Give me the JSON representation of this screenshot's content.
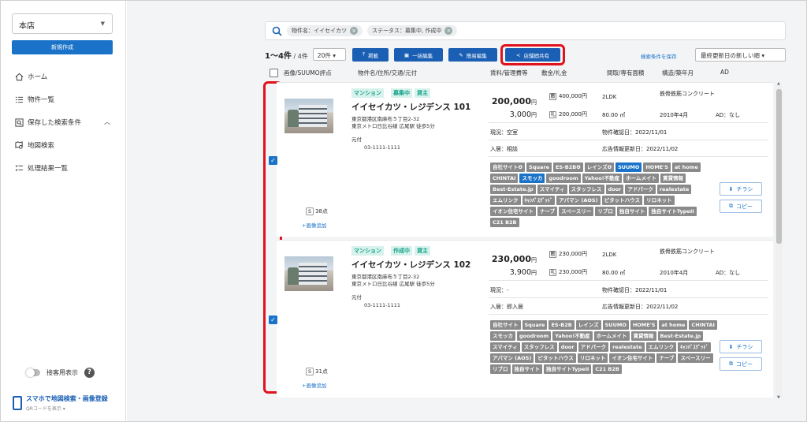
{
  "sidebar": {
    "store": "本店",
    "new_button": "新規作成",
    "nav": {
      "home": "ホーム",
      "list": "物件一覧",
      "saved": "保存した検索条件",
      "map": "地図検索",
      "results": "処理結果一覧"
    },
    "toggle_label": "接客用表示",
    "mobile_title": "スマホで地図検索・画像登録",
    "mobile_sub": "QRコードを表示 ▾"
  },
  "search": {
    "chip1": "物件名：イイセイカツ",
    "chip2": "ステータス：募集中, 作成中"
  },
  "toolbar": {
    "count": "1〜4件",
    "total": " / 4件",
    "per_page": "20件 ▾",
    "publish": "掲載",
    "bulk_edit": "一括編集",
    "quick_edit": "簡易編集",
    "share": "店舗間共有",
    "save_condition": "検索条件を保存",
    "sort": "最終更新日の新しい順 ▾"
  },
  "headers": {
    "image": "画像/SUUMO評点",
    "name": "物件名/住所/交通/元付",
    "rent": "賃料/管理費等",
    "deposit": "敷金/礼金",
    "layout": "間取/専有面積",
    "structure": "構造/築年月",
    "ad": "AD"
  },
  "buttons": {
    "flyer": "チラシ",
    "copy": "コピー"
  },
  "listings": [
    {
      "type": "マンション",
      "status": "募集中",
      "kashi": "貸主",
      "name": "イイセイカツ・レジデンス 101",
      "address": "東京都港区南麻布５丁目2-32",
      "access": "東京メトロ日比谷線 広尾駅 徒歩5分",
      "motozuke": "元付",
      "phone": "03-1111-1111",
      "rent": "200,000",
      "fee": "3,000",
      "yen": "円",
      "deposit_label": "敷",
      "deposit": "400,000円",
      "key_label": "礼",
      "key_money": "200,000円",
      "layout": "2LDK",
      "area": "80.00 ㎡",
      "structure": "鉄骨鉄筋コンクリート",
      "built": "2010年4月",
      "ad": "AD：なし",
      "current": "現況：空室",
      "confirm": "物件確認日：2022/11/01",
      "move_in": "入居：相談",
      "ad_updated": "広告情報更新日：2022/11/02",
      "score": "38点",
      "score_label": "S",
      "add_image": "+画像追加",
      "checked": true,
      "sites": [
        {
          "t": "自社サイト❶",
          "blue": false
        },
        {
          "t": "Square",
          "blue": false
        },
        {
          "t": "ES-B2B❶",
          "blue": false
        },
        {
          "t": "レインズ❶",
          "blue": false
        },
        {
          "t": "SUUMO",
          "blue": true
        },
        {
          "t": "HOME'S",
          "blue": false
        },
        {
          "t": "at home",
          "blue": false
        },
        {
          "t": "CHINTAI",
          "blue": false
        },
        {
          "t": "スモッカ",
          "blue": true
        },
        {
          "t": "goodroom",
          "blue": false
        },
        {
          "t": "Yahoo!不動産",
          "blue": false
        },
        {
          "t": "ホームメイト",
          "blue": false
        },
        {
          "t": "賃貸情報",
          "blue": false
        },
        {
          "t": "Best-Estate.jp",
          "blue": false
        },
        {
          "t": "スマイティ",
          "blue": false
        },
        {
          "t": "スタッフレス",
          "blue": false
        },
        {
          "t": "door",
          "blue": false
        },
        {
          "t": "アドパーク",
          "blue": false
        },
        {
          "t": "realestate",
          "blue": false
        },
        {
          "t": "エムリンク",
          "blue": false
        },
        {
          "t": "ｷｬﾝﾊﾟｽｸﾞｯﾄﾞ",
          "blue": false
        },
        {
          "t": "アパマン (AOS)",
          "blue": false
        },
        {
          "t": "ピタットハウス",
          "blue": false
        },
        {
          "t": "リロネット",
          "blue": false
        },
        {
          "t": "イオン住宅サイト",
          "blue": false
        },
        {
          "t": "ナーブ",
          "blue": false
        },
        {
          "t": "スペースリー",
          "blue": false
        },
        {
          "t": "リブロ",
          "blue": false
        },
        {
          "t": "独自サイト",
          "blue": false
        },
        {
          "t": "独自サイトTypeII",
          "blue": false
        },
        {
          "t": "C21 B2B",
          "blue": false
        }
      ]
    },
    {
      "type": "マンション",
      "status": "作成中",
      "kashi": "貸主",
      "name": "イイセイカツ・レジデンス 102",
      "address": "東京都港区南麻布５丁目2-32",
      "access": "東京メトロ日比谷線 広尾駅 徒歩5分",
      "motozuke": "元付",
      "phone": "03-1111-1111",
      "rent": "230,000",
      "fee": "3,900",
      "yen": "円",
      "deposit_label": "敷",
      "deposit": "230,000円",
      "key_label": "礼",
      "key_money": "230,000円",
      "layout": "2LDK",
      "area": "80.00 ㎡",
      "structure": "鉄骨鉄筋コンクリート",
      "built": "2010年4月",
      "ad": "AD：なし",
      "current": "現況：-",
      "confirm": "物件確認日：2022/11/01",
      "move_in": "入居：即入居",
      "ad_updated": "広告情報更新日：2022/11/02",
      "score": "31点",
      "score_label": "S",
      "add_image": "+画像追加",
      "checked": true,
      "sites": [
        {
          "t": "自社サイト",
          "blue": false
        },
        {
          "t": "Square",
          "blue": false
        },
        {
          "t": "ES-B2B",
          "blue": false
        },
        {
          "t": "レインズ",
          "blue": false
        },
        {
          "t": "SUUMO",
          "blue": false
        },
        {
          "t": "HOME'S",
          "blue": false
        },
        {
          "t": "at home",
          "blue": false
        },
        {
          "t": "CHINTAI",
          "blue": false
        },
        {
          "t": "スモッカ",
          "blue": false
        },
        {
          "t": "goodroom",
          "blue": false
        },
        {
          "t": "Yahoo!不動産",
          "blue": false
        },
        {
          "t": "ホームメイト",
          "blue": false
        },
        {
          "t": "賃貸情報",
          "blue": false
        },
        {
          "t": "Best-Estate.jp",
          "blue": false
        },
        {
          "t": "スマイティ",
          "blue": false
        },
        {
          "t": "スタッフレス",
          "blue": false
        },
        {
          "t": "door",
          "blue": false
        },
        {
          "t": "アドパーク",
          "blue": false
        },
        {
          "t": "realestate",
          "blue": false
        },
        {
          "t": "エムリンク",
          "blue": false
        },
        {
          "t": "ｷｬﾝﾊﾟｽｸﾞｯﾄﾞ",
          "blue": false
        },
        {
          "t": "アパマン (AOS)",
          "blue": false
        },
        {
          "t": "ピタットハウス",
          "blue": false
        },
        {
          "t": "リロネット",
          "blue": false
        },
        {
          "t": "イオン住宅サイト",
          "blue": false
        },
        {
          "t": "ナーブ",
          "blue": false
        },
        {
          "t": "スペースリー",
          "blue": false
        },
        {
          "t": "リブロ",
          "blue": false
        },
        {
          "t": "独自サイト",
          "blue": false
        },
        {
          "t": "独自サイトTypeII",
          "blue": false
        },
        {
          "t": "C21 B2B",
          "blue": false
        }
      ]
    }
  ],
  "colors": {
    "primary": "#1a5fb4",
    "highlight": "#e0121c",
    "tag_green": "#18a28a"
  }
}
